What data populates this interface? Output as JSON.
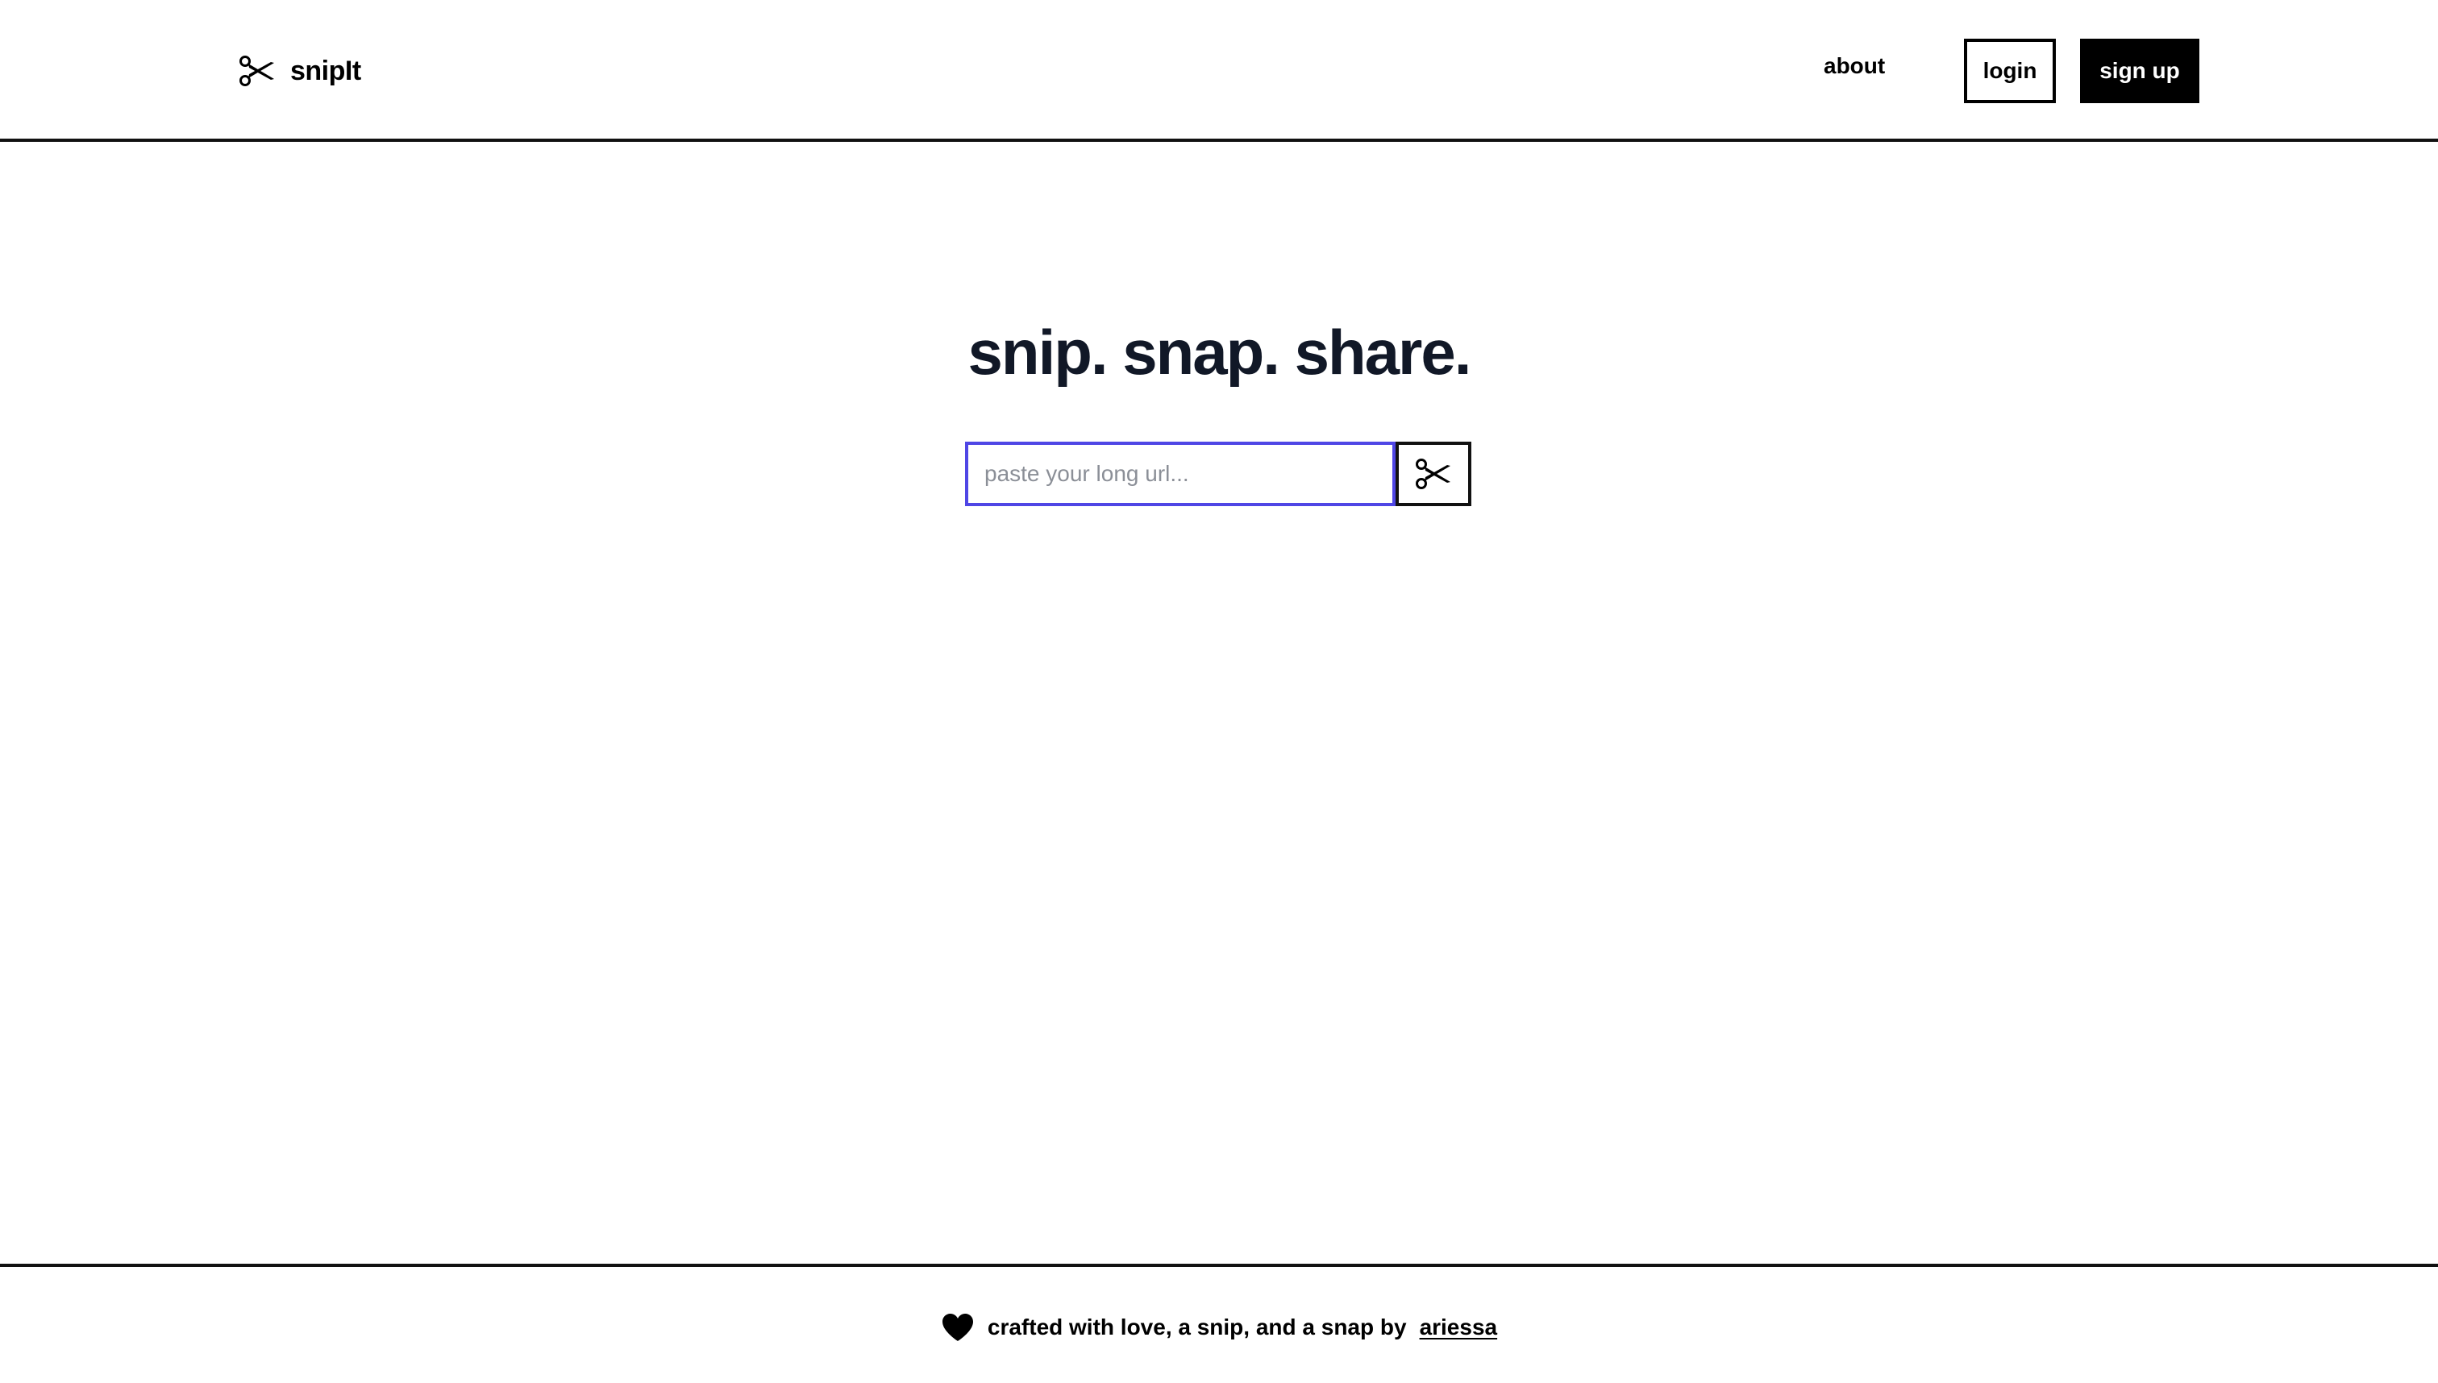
{
  "header": {
    "brand_name": "snipIt",
    "brand_icon": "scissors-icon",
    "nav": {
      "about_label": "about",
      "login_label": "login",
      "signup_label": "sign up"
    }
  },
  "hero": {
    "headline": "snip. snap. share.",
    "url_input": {
      "value": "",
      "placeholder": "paste your long url..."
    },
    "submit_icon": "scissors-icon"
  },
  "footer": {
    "icon": "heart-icon",
    "text": "crafted with love, a snip, and a snap by",
    "author_link": "ariessa"
  },
  "colors": {
    "text": "#000000",
    "headline": "#111827",
    "input_focus_border": "#4f46e5",
    "signup_bg": "#000000",
    "signup_text": "#ffffff",
    "placeholder": "#8b8f97",
    "background": "#ffffff"
  }
}
